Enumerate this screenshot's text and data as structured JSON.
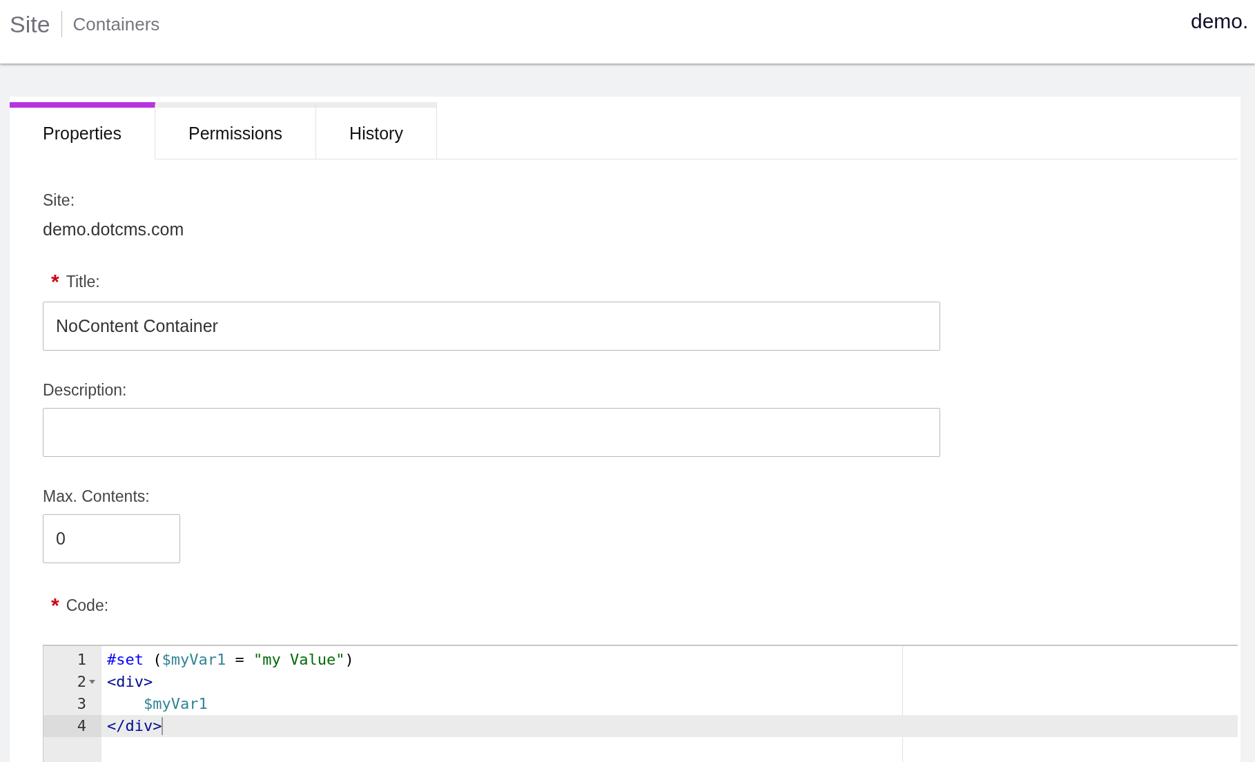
{
  "header": {
    "site": "Site",
    "section": "Containers",
    "host": "demo."
  },
  "tabs": [
    {
      "label": "Properties",
      "selected": true
    },
    {
      "label": "Permissions",
      "selected": false
    },
    {
      "label": "History",
      "selected": false
    }
  ],
  "site": {
    "label": "Site:",
    "value": "demo.dotcms.com"
  },
  "fields": [
    {
      "label": "Title:",
      "required_mark": "*",
      "value": "NoContent Container",
      "kind": "text"
    },
    {
      "label": "Description:",
      "kind": "text"
    },
    {
      "label": "Max. Contents:",
      "value": "0",
      "kind": "number"
    }
  ],
  "code": {
    "label": "Code:",
    "required_mark": "*",
    "lines": [
      {
        "number": "1",
        "active": false,
        "tokens": [
          {
            "kind": "keyword",
            "text": "#set"
          },
          {
            "kind": "plain",
            "text": " ("
          },
          {
            "kind": "variable",
            "text": "$myVar1"
          },
          {
            "kind": "plain",
            "text": " = "
          },
          {
            "kind": "string",
            "text": "\"my Value\""
          },
          {
            "kind": "plain",
            "text": ")"
          }
        ]
      },
      {
        "number": "2",
        "foldable": true,
        "active": false,
        "tokens": [
          {
            "kind": "tag",
            "text": "<div>"
          }
        ]
      },
      {
        "number": "3",
        "active": false,
        "tokens": [
          {
            "kind": "variable",
            "text": "    $myVar1"
          }
        ]
      },
      {
        "number": "4",
        "active": true,
        "tokens": [
          {
            "kind": "tag",
            "text": "</div>"
          }
        ]
      }
    ]
  }
}
